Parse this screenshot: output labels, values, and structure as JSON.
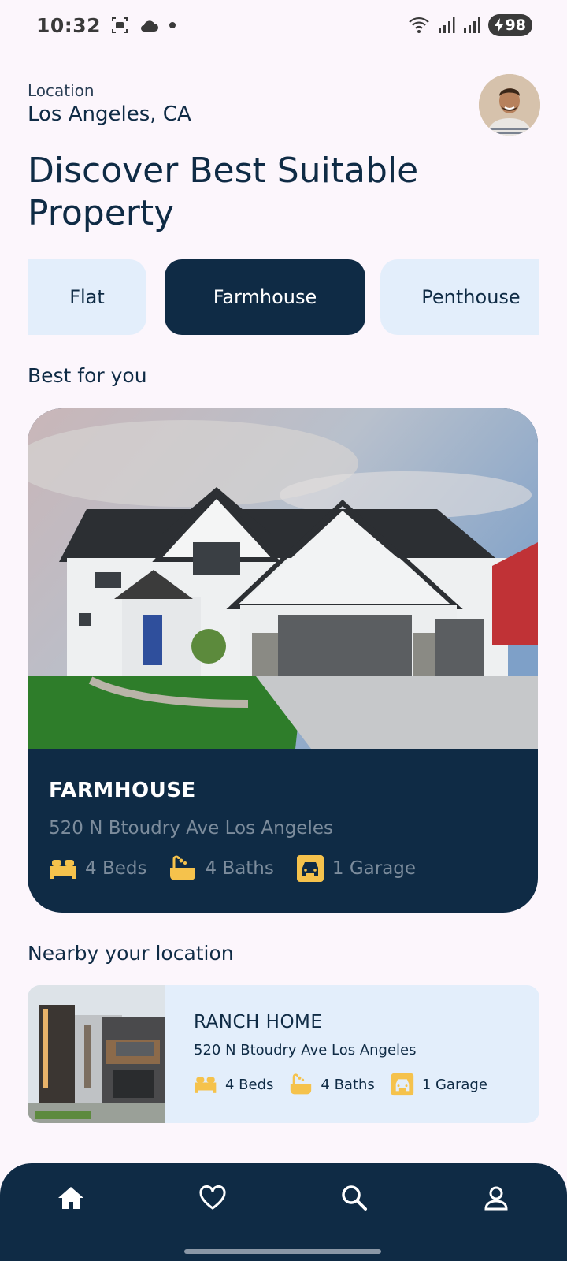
{
  "status_bar": {
    "time": "10:32",
    "battery": "98"
  },
  "header": {
    "location_label": "Location",
    "location_value": "Los Angeles, CA",
    "title": "Discover Best Suitable Property"
  },
  "categories": [
    {
      "label": "Flat",
      "active": false
    },
    {
      "label": "Farmhouse",
      "active": true
    },
    {
      "label": "Penthouse",
      "active": false
    }
  ],
  "best_section": {
    "title": "Best for you",
    "card": {
      "name": "FARMHOUSE",
      "address": "520 N Btoudry Ave Los Angeles",
      "beds": "4 Beds",
      "baths": "4 Baths",
      "garage": "1 Garage"
    }
  },
  "nearby_section": {
    "title": "Nearby your location",
    "card": {
      "name": "RANCH HOME",
      "address": "520 N Btoudry Ave Los Angeles",
      "beds": "4 Beds",
      "baths": "4 Baths",
      "garage": "1 Garage"
    }
  },
  "nav": {
    "items": [
      {
        "icon": "home-icon",
        "active": true
      },
      {
        "icon": "heart-icon",
        "active": false
      },
      {
        "icon": "search-icon",
        "active": false
      },
      {
        "icon": "profile-icon",
        "active": false
      }
    ]
  },
  "colors": {
    "primary": "#0f2b45",
    "chip_bg": "#e3eefb",
    "accent": "#f5c24c",
    "background": "#fcf6fc"
  }
}
